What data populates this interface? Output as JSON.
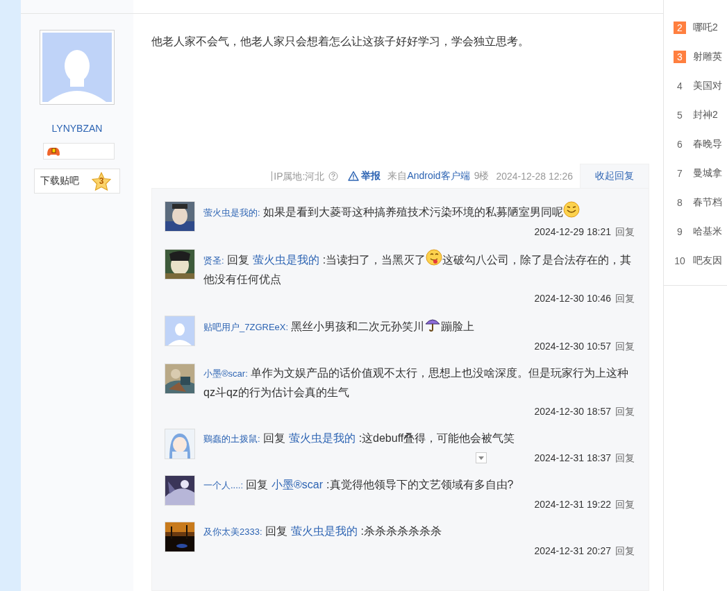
{
  "author": {
    "name": "LYNYBZAN",
    "badge_level": "3",
    "download_label": "下载贴吧"
  },
  "post": {
    "text": "他老人家不会气，他老人家只会想着怎么让这孩子好好学习，学会独立思考。",
    "ip": "IP属地:河北",
    "report": "举报",
    "source_prefix": "来自",
    "source": "Android客户端",
    "floor": "9楼",
    "time": "2024-12-28 12:26",
    "toggle_replies": "收起回复"
  },
  "comments": [
    {
      "default_avatar": false,
      "user": "萤火虫是我的:",
      "segments": [
        {
          "kind": "text",
          "text": "如果是看到大菱哥这种搞养殖技术污染环境的私募陋室男同呢"
        },
        {
          "kind": "smile"
        }
      ],
      "time": "2024-12-29 18:21",
      "reply": "回复",
      "menu": false
    },
    {
      "default_avatar": false,
      "user": "贤圣:",
      "segments": [
        {
          "kind": "text",
          "text": "回复"
        },
        {
          "kind": "user",
          "text": "萤火虫是我的"
        },
        {
          "kind": "text",
          "text": ":当读扫了，当黑灭了"
        },
        {
          "kind": "tongue"
        },
        {
          "kind": "text",
          "text": "这破勾八公司，除了是合法存在的，其他没有任何优点"
        }
      ],
      "time": "2024-12-30 10:46",
      "reply": "回复",
      "menu": false
    },
    {
      "default_avatar": true,
      "user": "贴吧用户_7ZGREeX:",
      "segments": [
        {
          "kind": "text",
          "text": "黑丝小男孩和二次元孙笑川"
        },
        {
          "kind": "umbrella"
        },
        {
          "kind": "text",
          "text": "蹦脸上"
        }
      ],
      "time": "2024-12-30 10:57",
      "reply": "回复",
      "menu": false
    },
    {
      "default_avatar": false,
      "user": "小墨®scar:",
      "segments": [
        {
          "kind": "text",
          "text": "单作为文娱产品的话价值观不太行，思想上也没啥深度。但是玩家行为上这种qz斗qz的行为估计会真的生气"
        }
      ],
      "time": "2024-12-30 18:57",
      "reply": "回复",
      "menu": false
    },
    {
      "default_avatar": false,
      "user": "鷄蠢的土拨鼠:",
      "segments": [
        {
          "kind": "text",
          "text": "回复"
        },
        {
          "kind": "user",
          "text": "萤火虫是我的"
        },
        {
          "kind": "text",
          "text": ":这debuff叠得，可能他会被气笑"
        }
      ],
      "time": "2024-12-31 18:37",
      "reply": "回复",
      "menu": true
    },
    {
      "default_avatar": false,
      "user": "一个人....:",
      "segments": [
        {
          "kind": "text",
          "text": "回复"
        },
        {
          "kind": "user",
          "text": "小墨®scar"
        },
        {
          "kind": "text",
          "text": ":真觉得他领导下的文艺领域有多自由?"
        }
      ],
      "time": "2024-12-31 19:22",
      "reply": "回复",
      "menu": false
    },
    {
      "default_avatar": false,
      "user": "及你太美2333:",
      "segments": [
        {
          "kind": "text",
          "text": "回复"
        },
        {
          "kind": "user",
          "text": "萤火虫是我的"
        },
        {
          "kind": "text",
          "text": ":杀杀杀杀杀杀杀"
        }
      ],
      "time": "2024-12-31 20:27",
      "reply": "回复",
      "menu": false
    }
  ],
  "hot_list": [
    {
      "rank": "2",
      "title": "哪吒2",
      "highlighted": true
    },
    {
      "rank": "3",
      "title": "射雕英",
      "highlighted": true
    },
    {
      "rank": "4",
      "title": "美国对",
      "highlighted": false
    },
    {
      "rank": "5",
      "title": "封神2",
      "highlighted": false
    },
    {
      "rank": "6",
      "title": "春晚导",
      "highlighted": false
    },
    {
      "rank": "7",
      "title": "曼城拿",
      "highlighted": false
    },
    {
      "rank": "8",
      "title": "春节档",
      "highlighted": false
    },
    {
      "rank": "9",
      "title": "哈基米",
      "highlighted": false
    },
    {
      "rank": "10",
      "title": "吧友因",
      "highlighted": false
    }
  ]
}
